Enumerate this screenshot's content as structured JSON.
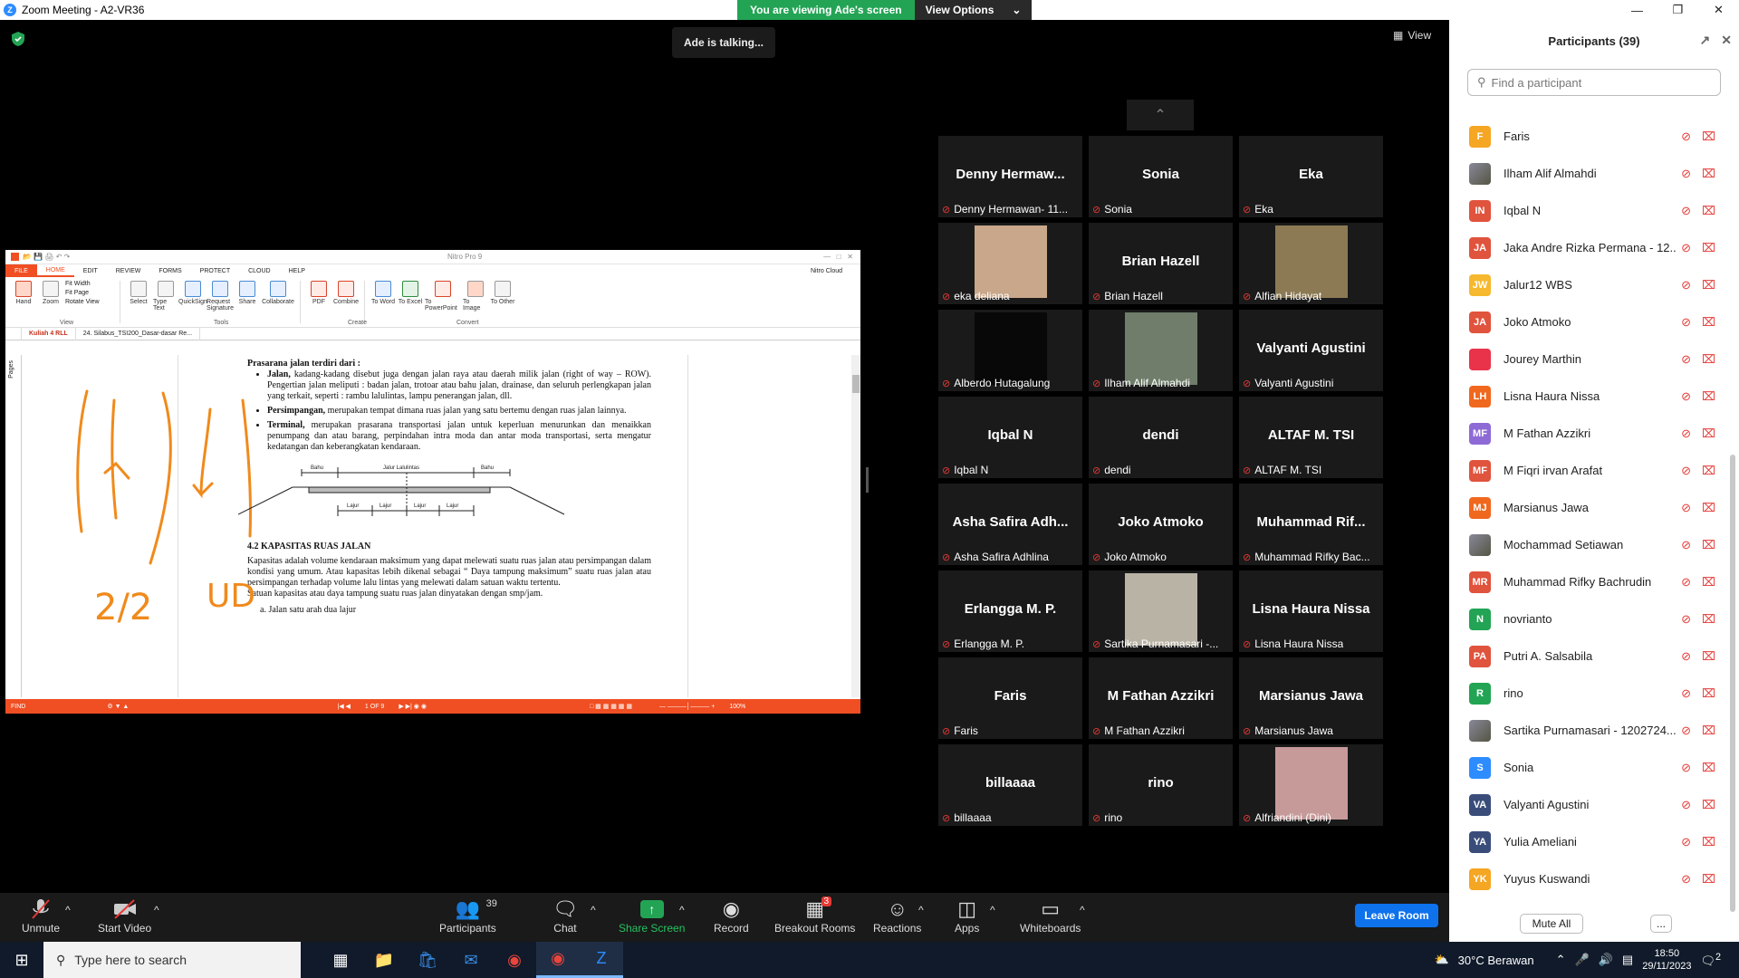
{
  "window": {
    "title": "Zoom Meeting - A2-VR36",
    "app_icon": "zoom-icon"
  },
  "banner": {
    "viewing": "You are viewing Ade's screen",
    "options": "View Options"
  },
  "talking": "Ade is talking...",
  "view_button": "View",
  "shared_screen": {
    "app_title": "Nitro Pro 9",
    "menu": [
      "FILE",
      "HOME",
      "EDIT",
      "REVIEW",
      "FORMS",
      "PROTECT",
      "CLOUD",
      "HELP"
    ],
    "cloud_user": "Nitro Cloud",
    "tools": [
      {
        "label": "Hand",
        "group": "View"
      },
      {
        "label": "Zoom",
        "group": "View"
      },
      {
        "label": "Select",
        "group": "Tools"
      },
      {
        "label": "Type Text",
        "group": "Tools"
      },
      {
        "label": "QuickSign",
        "group": "Tools"
      },
      {
        "label": "Request Signature",
        "group": "Tools"
      },
      {
        "label": "Share",
        "group": "Tools"
      },
      {
        "label": "Collaborate",
        "group": "Tools"
      },
      {
        "label": "PDF",
        "group": "Create"
      },
      {
        "label": "Combine",
        "group": "Create"
      },
      {
        "label": "To Word",
        "group": "Convert"
      },
      {
        "label": "To Excel",
        "group": "Convert"
      },
      {
        "label": "To PowerPoint",
        "group": "Convert"
      },
      {
        "label": "To Image",
        "group": "Convert"
      },
      {
        "label": "To Other",
        "group": "Convert"
      }
    ],
    "view_options": [
      "Fit Width",
      "Fit Page",
      "Rotate View"
    ],
    "groups": [
      "View",
      "Tools",
      "Create",
      "Convert"
    ],
    "tabs": [
      "Kuliah 4 RLL",
      "24. Silabus_TSI200_Dasar-dasar Re..."
    ],
    "pages_label": "Pages",
    "doc": {
      "intro": "Prasarana jalan terdiri dari :",
      "bullets": [
        {
          "term": "Jalan,",
          "text": "kadang-kadang disebut juga dengan jalan raya atau daerah milik jalan (right of way – ROW). Pengertian jalan meliputi : badan jalan, trotoar atau bahu jalan, drainase, dan seluruh perlengkapan jalan yang terkait, seperti : rambu lalulintas, lampu penerangan jalan, dll."
        },
        {
          "term": "Persimpangan,",
          "text": "merupakan tempat dimana ruas jalan yang satu bertemu dengan ruas jalan lainnya."
        },
        {
          "term": "Terminal,",
          "text": "merupakan prasarana transportasi jalan untuk keperluan menurunkan dan menaikkan penumpang dan atau barang, perpindahan intra moda dan antar moda transportasi, serta mengatur kedatangan dan keberangkatan kendaraan."
        }
      ],
      "diagram_labels": {
        "bahu": "Bahu",
        "jalur": "Jalur Lalulintas",
        "lajur": "Lajur"
      },
      "section_title": "4.2  KAPASITAS RUAS JALAN",
      "section_text": "Kapasitas adalah volume kendaraan maksimum yang dapat melewati suatu ruas jalan atau persimpangan dalam kondisi yang umum. Atau kapasitas lebih dikenal sebagai “ Daya tampung maksimum”  suatu ruas jalan atau persimpangan terhadap volume lalu lintas yang melewati dalam satuan waktu tertentu.",
      "section_text2": "Satuan kapasitas atau daya tampung suatu ruas jalan dinyatakan dengan smp/jam.",
      "list_a": "a.   Jalan satu arah dua lajur",
      "annotations": [
        "2/2",
        "UD"
      ]
    },
    "status": {
      "find": "FIND",
      "page": "1 OF 9",
      "zoom": "100%"
    }
  },
  "gallery": [
    {
      "big": "Denny  Hermaw...",
      "label": "Denny Hermawan- 11...",
      "photo": false
    },
    {
      "big": "Sonia",
      "label": "Sonia",
      "photo": false
    },
    {
      "big": "Eka",
      "label": "Eka",
      "photo": false
    },
    {
      "big": "",
      "label": "eka deliana",
      "photo": true,
      "tone": "#c9a78a"
    },
    {
      "big": "Brian Hazell",
      "label": "Brian Hazell",
      "photo": false
    },
    {
      "big": "",
      "label": "Alfian Hidayat",
      "photo": true,
      "tone": "#8c7a55"
    },
    {
      "big": "",
      "label": "Alberdo Hutagalung",
      "photo": true,
      "tone": "#080808"
    },
    {
      "big": "",
      "label": "Ilham Alif Almahdi",
      "photo": true,
      "tone": "#6f7d6a"
    },
    {
      "big": "Valyanti Agustini",
      "label": "Valyanti Agustini",
      "photo": false
    },
    {
      "big": "Iqbal N",
      "label": "Iqbal N",
      "photo": false
    },
    {
      "big": "dendi",
      "label": "dendi",
      "photo": false
    },
    {
      "big": "ALTAF M. TSI",
      "label": "ALTAF M. TSI",
      "photo": false
    },
    {
      "big": "Asha Safira Adh...",
      "label": "Asha Safira Adhlina",
      "photo": false
    },
    {
      "big": "Joko Atmoko",
      "label": "Joko Atmoko",
      "photo": false
    },
    {
      "big": "Muhammad  Rif...",
      "label": "Muhammad Rifky Bac...",
      "photo": false
    },
    {
      "big": "Erlangga M. P.",
      "label": "Erlangga M. P.",
      "photo": false
    },
    {
      "big": "",
      "label": "Sartika Purnamasari -...",
      "photo": true,
      "tone": "#b9b3a6"
    },
    {
      "big": "Lisna Haura Nissa",
      "label": "Lisna Haura Nissa",
      "photo": false
    },
    {
      "big": "Faris",
      "label": "Faris",
      "photo": false
    },
    {
      "big": "M Fathan Azzikri",
      "label": "M Fathan Azzikri",
      "photo": false
    },
    {
      "big": "Marsianus Jawa",
      "label": "Marsianus Jawa",
      "photo": false
    },
    {
      "big": "billaaaa",
      "label": "billaaaa",
      "photo": false
    },
    {
      "big": "rino",
      "label": "rino",
      "photo": false
    },
    {
      "big": "",
      "label": "Alfriandini (Dini)",
      "photo": true,
      "tone": "#c79a9a"
    }
  ],
  "participants_panel": {
    "title": "Participants (39)",
    "search_placeholder": "Find a participant",
    "list": [
      {
        "initials": "F",
        "name": "Faris",
        "color": "#f5a623"
      },
      {
        "initials": "",
        "name": "Ilham Alif Almahdi",
        "color": "#7a8a70",
        "img": true
      },
      {
        "initials": "IN",
        "name": "Iqbal N",
        "color": "#e0533d"
      },
      {
        "initials": "JA",
        "name": "Jaka Andre Rizka Permana - 12...",
        "color": "#e0533d"
      },
      {
        "initials": "JW",
        "name": "Jalur12 WBS",
        "color": "#f5b82e"
      },
      {
        "initials": "JA",
        "name": "Joko Atmoko",
        "color": "#e0533d"
      },
      {
        "initials": "",
        "name": "Jourey Marthin",
        "color": "#e8334a"
      },
      {
        "initials": "LH",
        "name": "Lisna Haura Nissa",
        "color": "#f0681d"
      },
      {
        "initials": "MF",
        "name": "M Fathan Azzikri",
        "color": "#8e6ad6"
      },
      {
        "initials": "MF",
        "name": "M Fiqri irvan Arafat",
        "color": "#e0533d"
      },
      {
        "initials": "MJ",
        "name": "Marsianus Jawa",
        "color": "#f0681d"
      },
      {
        "initials": "",
        "name": "Mochammad Setiawan",
        "color": "#8a7a8a",
        "img": true
      },
      {
        "initials": "MR",
        "name": "Muhammad Rifky Bachrudin",
        "color": "#e0533d"
      },
      {
        "initials": "N",
        "name": "novrianto",
        "color": "#23a455"
      },
      {
        "initials": "PA",
        "name": "Putri A. Salsabila",
        "color": "#e0533d"
      },
      {
        "initials": "R",
        "name": "rino",
        "color": "#23a455"
      },
      {
        "initials": "",
        "name": "Sartika Purnamasari - 1202724...",
        "color": "#b6aa9a",
        "img": true
      },
      {
        "initials": "S",
        "name": "Sonia",
        "color": "#2d8cff"
      },
      {
        "initials": "VA",
        "name": "Valyanti Agustini",
        "color": "#3a4d7a"
      },
      {
        "initials": "YA",
        "name": "Yulia Ameliani",
        "color": "#3a4d7a"
      },
      {
        "initials": "YK",
        "name": "Yuyus Kuswandi",
        "color": "#f5a623"
      }
    ],
    "mute_all": "Mute All",
    "more": "..."
  },
  "toolbar": {
    "unmute": "Unmute",
    "start_video": "Start Video",
    "participants": "Participants",
    "participants_count": "39",
    "chat": "Chat",
    "share": "Share Screen",
    "record": "Record",
    "breakout": "Breakout Rooms",
    "breakout_badge": "3",
    "reactions": "Reactions",
    "apps": "Apps",
    "whiteboards": "Whiteboards",
    "leave": "Leave Room"
  },
  "taskbar": {
    "search_placeholder": "Type here to search",
    "weather": "30°C  Berawan",
    "time": "18:50",
    "date": "29/11/2023",
    "notif": "2"
  }
}
